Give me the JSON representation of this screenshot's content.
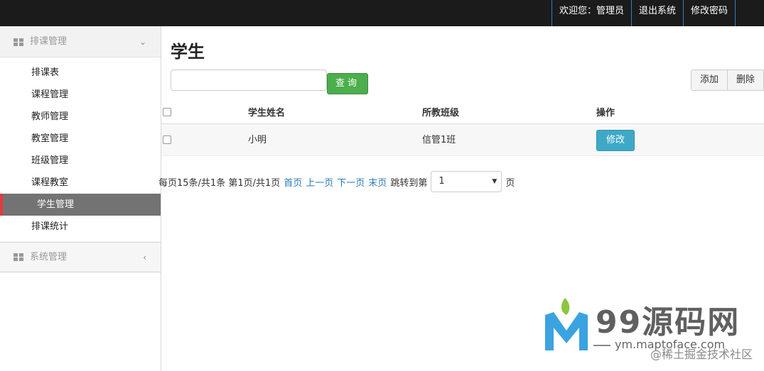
{
  "topnav": {
    "welcome": "欢迎您：管理员",
    "logout": "退出系统",
    "change_password": "修改密码"
  },
  "sidebar": {
    "group1": {
      "label": "排课管理",
      "icon": "grid-icon",
      "chevron": "chevron-down-icon",
      "items": [
        {
          "label": "排课表"
        },
        {
          "label": "课程管理"
        },
        {
          "label": "教师管理"
        },
        {
          "label": "教室管理"
        },
        {
          "label": "班级管理"
        },
        {
          "label": "课程教室"
        },
        {
          "label": "学生管理",
          "active": true
        },
        {
          "label": "排课统计"
        }
      ]
    },
    "group2": {
      "label": "系统管理",
      "icon": "grid-icon",
      "chevron": "chevron-left-icon"
    }
  },
  "main": {
    "title": "学生",
    "search": {
      "value": "",
      "button": "查询"
    },
    "actions": {
      "add": "添加",
      "delete": "删除"
    },
    "table": {
      "headers": [
        "学生姓名",
        "所教班级",
        "操作"
      ],
      "rows": [
        {
          "name": "小明",
          "class": "信管1班",
          "action": "修改"
        }
      ]
    },
    "pager": {
      "summary": "每页15条/共1条 第1页/共1页",
      "first": "首页",
      "prev": "上一页",
      "next": "下一页",
      "last": "末页",
      "jump_label": "跳转到第",
      "selected_page": "1",
      "suffix": "页"
    }
  },
  "watermark": {
    "site": "99源码网",
    "url": "ym.maptoface.com",
    "credit": "@稀土掘金技术社区"
  },
  "colors": {
    "topbar": "#1b1b1b",
    "active_item": "#737373",
    "active_marker": "#e23b3b",
    "search_button": "#4cae4c",
    "edit_button": "#3ea9c7",
    "link": "#2a7ab8"
  }
}
